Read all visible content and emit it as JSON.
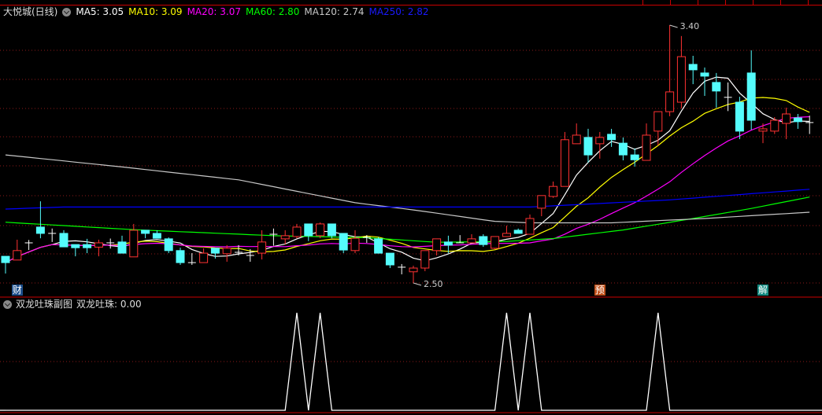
{
  "stock": {
    "name": "大悦城(日线)"
  },
  "legend": [
    {
      "label": "MA5: 3.05",
      "color": "#ffffff"
    },
    {
      "label": "MA10: 3.09",
      "color": "#ffff00"
    },
    {
      "label": "MA20: 3.07",
      "color": "#ff00ff"
    },
    {
      "label": "MA60: 2.80",
      "color": "#00ff00"
    },
    {
      "label": "MA120: 2.74",
      "color": "#c8c8c8"
    },
    {
      "label": "MA250: 2.82",
      "color": "#0000ff"
    }
  ],
  "subchart": {
    "title": "双龙吐珠副图",
    "value_label": "双龙吐珠: 0.00"
  },
  "colors": {
    "up": "#ff3232",
    "down": "#54fcfc",
    "doji": "#ffffff",
    "grid": "#8b1a1a",
    "sep": "#cc0000"
  },
  "events": [
    {
      "label": "财",
      "index": 1,
      "color": "#1e4f8c"
    },
    {
      "label": "预",
      "index": 51,
      "color": "#c0501a"
    },
    {
      "label": "解",
      "index": 65,
      "color": "#138a80"
    }
  ],
  "chart_data": [
    {
      "type": "candlestick",
      "title": "大悦城(日线)",
      "ylim": [
        2.5,
        3.4
      ],
      "annotations": [
        {
          "label": "3.40",
          "index": 57,
          "value": 3.4
        },
        {
          "label": "2.50",
          "index": 35,
          "value": 2.5
        }
      ],
      "ohlc": [
        [
          2.593,
          2.593,
          2.533,
          2.571
        ],
        [
          2.58,
          2.651,
          2.58,
          2.613
        ],
        [
          2.64,
          2.65,
          2.615,
          2.64
        ],
        [
          2.695,
          2.785,
          2.656,
          2.673
        ],
        [
          2.673,
          2.69,
          2.643,
          2.673
        ],
        [
          2.673,
          2.684,
          2.626,
          2.626
        ],
        [
          2.634,
          2.634,
          2.593,
          2.623
        ],
        [
          2.634,
          2.654,
          2.604,
          2.623
        ],
        [
          2.625,
          2.651,
          2.593,
          2.64
        ],
        [
          2.64,
          2.655,
          2.62,
          2.64
        ],
        [
          2.643,
          2.665,
          2.604,
          2.604
        ],
        [
          2.591,
          2.706,
          2.591,
          2.684
        ],
        [
          2.684,
          2.684,
          2.656,
          2.673
        ],
        [
          2.673,
          2.684,
          2.656,
          2.656
        ],
        [
          2.654,
          2.659,
          2.604,
          2.613
        ],
        [
          2.613,
          2.623,
          2.563,
          2.571
        ],
        [
          2.571,
          2.604,
          2.563,
          2.571
        ],
        [
          2.571,
          2.621,
          2.571,
          2.604
        ],
        [
          2.621,
          2.621,
          2.585,
          2.604
        ],
        [
          2.602,
          2.632,
          2.574,
          2.621
        ],
        [
          2.607,
          2.632,
          2.596,
          2.607
        ],
        [
          2.596,
          2.618,
          2.574,
          2.596
        ],
        [
          2.604,
          2.684,
          2.582,
          2.643
        ],
        [
          2.67,
          2.69,
          2.63,
          2.67
        ],
        [
          2.654,
          2.684,
          2.634,
          2.665
        ],
        [
          2.662,
          2.706,
          2.656,
          2.695
        ],
        [
          2.706,
          2.706,
          2.646,
          2.665
        ],
        [
          2.665,
          2.711,
          2.656,
          2.706
        ],
        [
          2.706,
          2.706,
          2.656,
          2.665
        ],
        [
          2.673,
          2.673,
          2.604,
          2.615
        ],
        [
          2.613,
          2.684,
          2.604,
          2.656
        ],
        [
          2.659,
          2.667,
          2.64,
          2.659
        ],
        [
          2.654,
          2.66,
          2.604,
          2.604
        ],
        [
          2.604,
          2.604,
          2.552,
          2.563
        ],
        [
          2.555,
          2.566,
          2.53,
          2.555
        ],
        [
          2.539,
          2.56,
          2.5,
          2.552
        ],
        [
          2.552,
          2.613,
          2.541,
          2.613
        ],
        [
          2.613,
          2.654,
          2.596,
          2.654
        ],
        [
          2.643,
          2.665,
          2.604,
          2.632
        ],
        [
          2.64,
          2.667,
          2.64,
          2.64
        ],
        [
          2.64,
          2.67,
          2.64,
          2.654
        ],
        [
          2.662,
          2.67,
          2.626,
          2.634
        ],
        [
          2.621,
          2.662,
          2.618,
          2.662
        ],
        [
          2.662,
          2.7,
          2.662,
          2.673
        ],
        [
          2.684,
          2.69,
          2.673,
          2.673
        ],
        [
          2.67,
          2.739,
          2.67,
          2.725
        ],
        [
          2.761,
          2.775,
          2.733,
          2.805
        ],
        [
          2.802,
          2.854,
          2.797,
          2.837
        ],
        [
          2.837,
          3.027,
          2.837,
          3.0
        ],
        [
          2.986,
          3.057,
          2.986,
          3.016
        ],
        [
          3.008,
          3.038,
          2.92,
          2.947
        ],
        [
          2.986,
          3.027,
          2.934,
          3.008
        ],
        [
          3.019,
          3.038,
          2.975,
          3.0
        ],
        [
          2.988,
          3.008,
          2.928,
          2.947
        ],
        [
          2.947,
          2.97,
          2.906,
          2.93
        ],
        [
          2.928,
          3.057,
          2.928,
          3.016
        ],
        [
          3.03,
          3.098,
          2.98,
          3.098
        ],
        [
          3.098,
          3.4,
          3.082,
          3.167
        ],
        [
          3.131,
          3.362,
          3.11,
          3.29
        ],
        [
          3.263,
          3.293,
          3.194,
          3.244
        ],
        [
          3.233,
          3.252,
          3.153,
          3.222
        ],
        [
          3.2,
          3.233,
          3.112,
          3.17
        ],
        [
          3.148,
          3.2,
          3.1,
          3.148
        ],
        [
          3.131,
          3.15,
          3.002,
          3.03
        ],
        [
          3.233,
          3.312,
          3.035,
          3.068
        ],
        [
          3.03,
          3.057,
          2.988,
          3.038
        ],
        [
          3.03,
          3.079,
          3.02,
          3.068
        ],
        [
          3.057,
          3.112,
          3.002,
          3.09
        ],
        [
          3.076,
          3.09,
          3.038,
          3.063
        ],
        [
          3.06,
          3.084,
          3.02,
          3.06
        ]
      ],
      "ma_series": [
        {
          "name": "MA5",
          "period": 5,
          "color": "#ffffff"
        },
        {
          "name": "MA10",
          "period": 10,
          "color": "#ffff00"
        },
        {
          "name": "MA20",
          "period": 20,
          "color": "#ff00ff"
        },
        {
          "name": "MA60",
          "color": "#00ff00",
          "points": [
            [
              0,
              2.712
            ],
            [
              11,
              2.686
            ],
            [
              23,
              2.665
            ],
            [
              31,
              2.658
            ],
            [
              37,
              2.642
            ],
            [
              43,
              2.645
            ],
            [
              47,
              2.655
            ],
            [
              53,
              2.685
            ],
            [
              59,
              2.725
            ],
            [
              64,
              2.76
            ],
            [
              69,
              2.8
            ]
          ]
        },
        {
          "name": "MA120",
          "color": "#c8c8c8",
          "points": [
            [
              0,
              2.947
            ],
            [
              10,
              2.905
            ],
            [
              20,
              2.86
            ],
            [
              30,
              2.78
            ],
            [
              35,
              2.755
            ],
            [
              42,
              2.715
            ],
            [
              45,
              2.71
            ],
            [
              52,
              2.71
            ],
            [
              60,
              2.725
            ],
            [
              69,
              2.747
            ]
          ]
        },
        {
          "name": "MA250",
          "color": "#0000ff",
          "points": [
            [
              0,
              2.758
            ],
            [
              5,
              2.765
            ],
            [
              45,
              2.765
            ],
            [
              57,
              2.79
            ],
            [
              69,
              2.827
            ]
          ]
        }
      ]
    },
    {
      "type": "line",
      "title": "双龙吐珠",
      "ylim": [
        0,
        1
      ],
      "values": [
        0,
        0,
        0,
        0,
        0,
        0,
        0,
        0,
        0,
        0,
        0,
        0,
        0,
        0,
        0,
        0,
        0,
        0,
        0,
        0,
        0,
        0,
        0,
        0,
        0,
        1,
        0,
        1,
        0,
        0,
        0,
        0,
        0,
        0,
        0,
        0,
        0,
        0,
        0,
        0,
        0,
        0,
        0,
        1,
        0,
        1,
        0,
        0,
        0,
        0,
        0,
        0,
        0,
        0,
        0,
        0,
        1,
        0,
        0,
        0,
        0,
        0,
        0,
        0,
        0,
        0,
        0,
        0,
        0,
        0
      ]
    }
  ]
}
